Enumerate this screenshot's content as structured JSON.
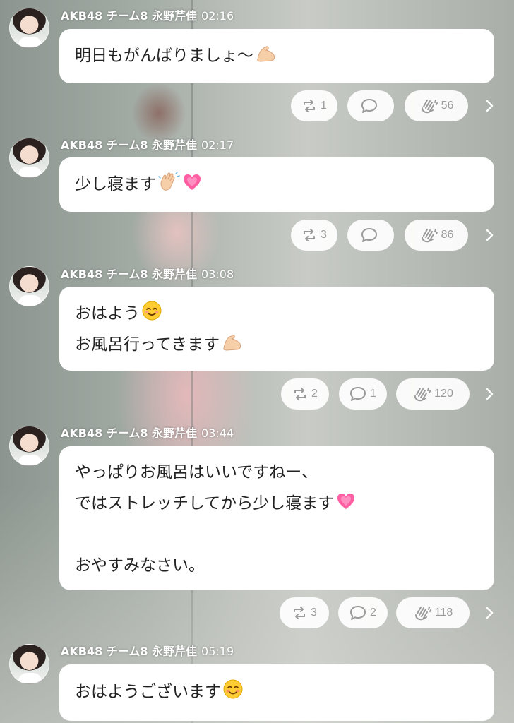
{
  "posts": [
    {
      "author": "AKB48 チーム8 永野芹佳",
      "time": "02:16",
      "lines": [
        "明日もがんばりましょ〜"
      ],
      "emojis": [
        "flexed-biceps"
      ],
      "retweets": "1",
      "replies": "",
      "claps": "56"
    },
    {
      "author": "AKB48 チーム8 永野芹佳",
      "time": "02:17",
      "lines": [
        "少し寝ます"
      ],
      "emojis": [
        "waving-hand",
        "growing-heart"
      ],
      "retweets": "3",
      "replies": "",
      "claps": "86"
    },
    {
      "author": "AKB48 チーム8 永野芹佳",
      "time": "03:08",
      "lines": [
        "おはよう",
        "お風呂行ってきます"
      ],
      "emojis": [
        "smiling-face",
        "flexed-biceps"
      ],
      "retweets": "2",
      "replies": "1",
      "claps": "120"
    },
    {
      "author": "AKB48 チーム8 永野芹佳",
      "time": "03:44",
      "lines": [
        "やっぱりお風呂はいいですねー、",
        "ではストレッチしてから少し寝ます",
        "",
        "おやすみなさい。"
      ],
      "emojis": [
        "growing-heart"
      ],
      "retweets": "3",
      "replies": "2",
      "claps": "118"
    },
    {
      "author": "AKB48 チーム8 永野芹佳",
      "time": "05:19",
      "lines": [
        "おはようございます"
      ],
      "emojis": [
        "smiling-face-blush"
      ]
    }
  ],
  "colors": {
    "bubble": "#ffffff",
    "pill": "#ffffff",
    "icon": "#9a9a9a",
    "heart": "#ff5fa2",
    "skin": "#f6cfa8"
  }
}
